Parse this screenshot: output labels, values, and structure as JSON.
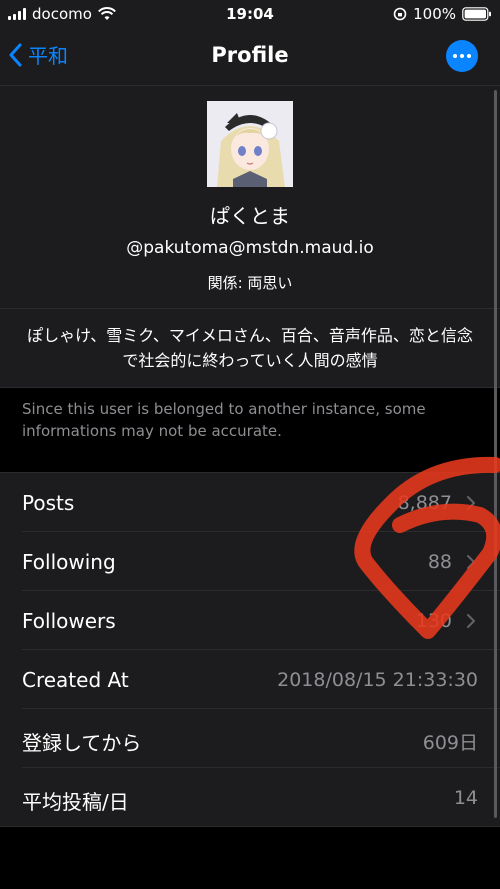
{
  "status": {
    "carrier": "docomo",
    "time": "19:04",
    "battery": "100%"
  },
  "nav": {
    "back_label": "平和",
    "title": "Profile"
  },
  "profile": {
    "display_name": "ぱくとま",
    "handle": "@pakutoma@mstdn.maud.io",
    "relation": "関係: 両思い",
    "bio": "ぽしゃけ、雪ミク、マイメロさん、百合、音声作品、恋と信念で社会的に終わっていく人間の感情"
  },
  "notice": "Since this user is belonged to another instance, some informations may not be accurate.",
  "stats": [
    {
      "label": "Posts",
      "value": "8,887"
    },
    {
      "label": "Following",
      "value": "88"
    },
    {
      "label": "Followers",
      "value": "130"
    },
    {
      "label": "Created At",
      "value": "2018/08/15 21:33:30"
    },
    {
      "label": "登録してから",
      "value": "609日"
    },
    {
      "label": "平均投稿/日",
      "value": "14"
    }
  ]
}
